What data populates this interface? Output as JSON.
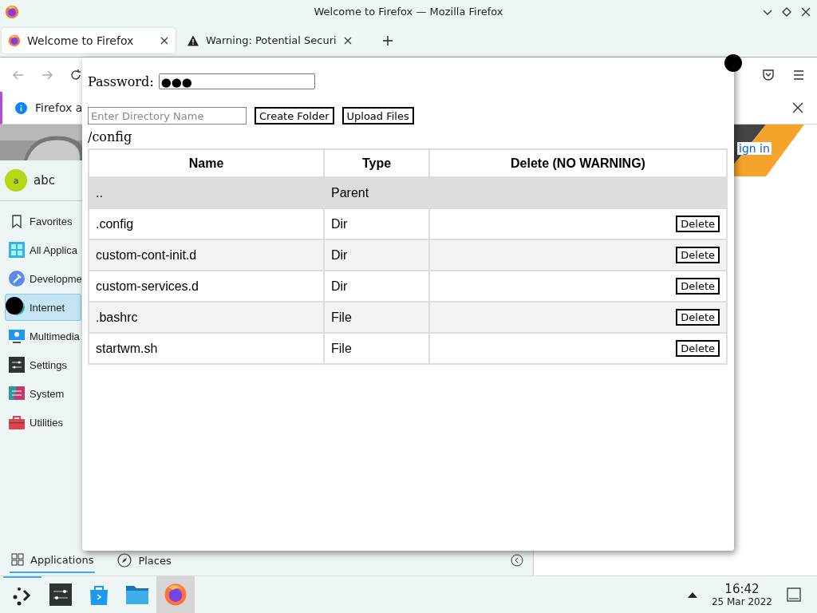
{
  "window": {
    "title": "Welcome to Firefox — Mozilla Firefox"
  },
  "tabs": [
    {
      "label": "Welcome to Firefox",
      "selected": true,
      "kind": "firefox"
    },
    {
      "label": "Warning: Potential Securi",
      "selected": false,
      "kind": "warning"
    }
  ],
  "notification": {
    "text": "Firefox a"
  },
  "page": {
    "link": "ign in"
  },
  "launcher": {
    "avatar": "a",
    "user": "abc",
    "categories": [
      {
        "label": "Favorites",
        "selected": false
      },
      {
        "label": "All Applica",
        "selected": false
      },
      {
        "label": "Developme",
        "selected": false
      },
      {
        "label": "Internet",
        "selected": true
      },
      {
        "label": "Multimedia",
        "selected": false
      },
      {
        "label": "Settings",
        "selected": false
      },
      {
        "label": "System",
        "selected": false
      },
      {
        "label": "Utilities",
        "selected": false
      }
    ],
    "tabs": [
      {
        "label": "Applications",
        "selected": true
      },
      {
        "label": "Places",
        "selected": false
      }
    ]
  },
  "dialog": {
    "password_label": "Password:",
    "password_value": "●●●",
    "directory_field": {
      "placeholder": "Enter Directory Name"
    },
    "buttons": [
      "Create Folder",
      "Upload Files"
    ],
    "path": "/config",
    "table": {
      "columns": [
        "Name",
        "Type",
        "Delete (NO WARNING)"
      ],
      "rows": [
        {
          "kind": "parent",
          "name": "..",
          "type": "Parent"
        },
        {
          "kind": "entry",
          "name": ".config",
          "type": "Dir",
          "action": "Delete"
        },
        {
          "kind": "entry",
          "name": "custom-cont-init.d",
          "type": "Dir",
          "action": "Delete"
        },
        {
          "kind": "entry",
          "name": "custom-services.d",
          "type": "Dir",
          "action": "Delete"
        },
        {
          "kind": "entry",
          "name": ".bashrc",
          "type": "File",
          "action": "Delete"
        },
        {
          "kind": "entry",
          "name": "startwm.sh",
          "type": "File",
          "action": "Delete"
        }
      ]
    }
  },
  "taskbar": {
    "time": "16:42",
    "date": "25 Mar 2022"
  }
}
